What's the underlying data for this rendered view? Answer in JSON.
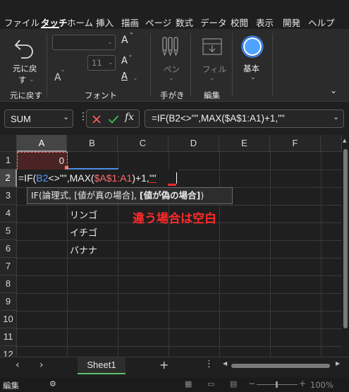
{
  "ribbon_tabs": [
    "ファイル",
    "タッチ",
    "ホーム",
    "挿入",
    "描画",
    "ページ",
    "数式",
    "データ",
    "校閲",
    "表示",
    "開発",
    "ヘルプ"
  ],
  "active_tab": "タッチ",
  "ribbon": {
    "undo_label_1": "元に戻",
    "undo_label_2": "す",
    "undo_group": "元に戻す",
    "font_group": "フォント",
    "font_size": "11",
    "grow_font": "A",
    "shrink_font": "A",
    "font_color": "A",
    "small_a": "A",
    "pen_label": "ペン",
    "handwriting_group": "手がき",
    "fill_label": "フィル",
    "edit_group": "編集",
    "style_label": "基本"
  },
  "formula_bar": {
    "name_box": "SUM",
    "formula": "=IF(B2<>\"\",MAX($A$1:A1)+1,\"\"",
    "fx_label": "fx"
  },
  "grid": {
    "columns": [
      "A",
      "B",
      "C",
      "D",
      "E",
      "F"
    ],
    "rows": [
      "1",
      "2",
      "3",
      "4",
      "5",
      "6",
      "7",
      "8",
      "9",
      "10",
      "11",
      "12"
    ],
    "a1_value": "0",
    "edit_formula": {
      "part1": "=IF(",
      "ref1": "B2",
      "part2": "<>\"\",MAX(",
      "ref2": "$A$1:A1",
      "part3": ")+1,",
      "part4": "\"\""
    },
    "tooltip": {
      "fn": "IF(論理式, [値が真の場合], ",
      "bold": "[値が偽の場合]",
      "end": ")"
    },
    "b4": "リンゴ",
    "b5": "イチゴ",
    "b6": "バナナ",
    "annotation": "違う場合は空白"
  },
  "sheet_tab": "Sheet1",
  "status": {
    "mode": "編集",
    "zoom": "100%"
  }
}
